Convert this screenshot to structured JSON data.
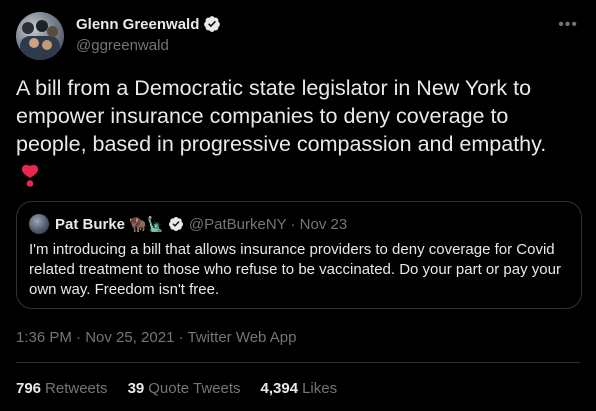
{
  "author": {
    "display_name": "Glenn Greenwald",
    "handle": "@ggreenwald",
    "avatar_icon": "group-photo-avatar",
    "verified_icon": "verified-badge-icon"
  },
  "more_icon": "•••",
  "tweet": {
    "text": "A bill from a Democratic state legislator in New York to empower insurance companies to deny coverage to people, based in progressive compassion and empathy.",
    "emoji": "❣️"
  },
  "quoted": {
    "display_name": "Pat Burke",
    "emojis": "🦬🗽",
    "handle": "@PatBurkeNY",
    "separator": "·",
    "date": "Nov 23",
    "text": "I'm introducing a bill that allows insurance providers to deny coverage for Covid related treatment to those who refuse to be vaccinated. Do your part or pay your own way. Freedom isn't free."
  },
  "meta": {
    "timestamp": "1:36 PM · Nov 25, 2021 · Twitter Web App"
  },
  "stats": {
    "retweets_count": "796",
    "retweets_label": "Retweets",
    "quotes_count": "39",
    "quotes_label": "Quote Tweets",
    "likes_count": "4,394",
    "likes_label": "Likes"
  },
  "colors": {
    "background": "#000000",
    "text": "#e7e9ea",
    "secondary": "#71767b",
    "border": "#2f3336",
    "heart": "#f91880"
  }
}
